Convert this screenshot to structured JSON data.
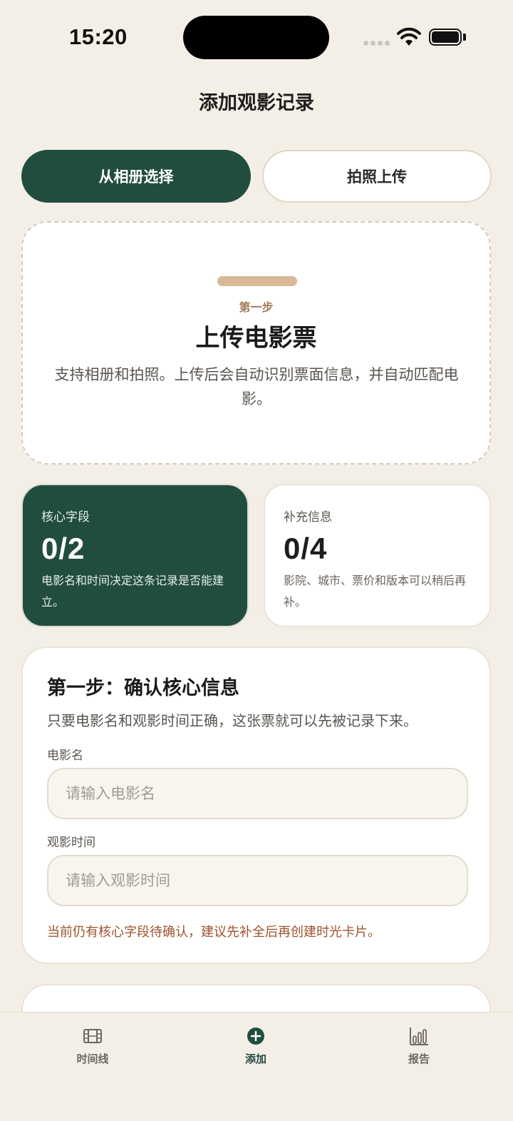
{
  "status_bar": {
    "time": "15:20"
  },
  "page": {
    "title": "添加观影记录"
  },
  "source_toggle": {
    "album_label": "从相册选择",
    "camera_label": "拍照上传"
  },
  "upload": {
    "step": "第一步",
    "title": "上传电影票",
    "description": "支持相册和拍照。上传后会自动识别票面信息，并自动匹配电影。"
  },
  "stats": {
    "core": {
      "label": "核心字段",
      "value": "0/2",
      "description": "电影名和时间决定这条记录是否能建立。"
    },
    "extra": {
      "label": "补充信息",
      "value": "0/4",
      "description": "影院、城市、票价和版本可以稍后再补。"
    }
  },
  "core_form": {
    "heading": "第一步：确认核心信息",
    "subtitle": "只要电影名和观影时间正确，这张票就可以先被记录下来。",
    "movie_label": "电影名",
    "movie_placeholder": "请输入电影名",
    "movie_value": "",
    "time_label": "观影时间",
    "time_placeholder": "请输入观影时间",
    "time_value": "",
    "warning": "当前仍有核心字段待确认，建议先补全后再创建时光卡片。"
  },
  "tab_bar": {
    "items": [
      {
        "label": "时间线",
        "icon": "film-icon"
      },
      {
        "label": "添加",
        "icon": "plus-circle-icon"
      },
      {
        "label": "报告",
        "icon": "bar-chart-icon"
      }
    ],
    "active": "添加"
  },
  "colors": {
    "background": "#f4efe6",
    "primary": "#214d40",
    "accent": "#d8b898",
    "warning": "#a0522d"
  }
}
